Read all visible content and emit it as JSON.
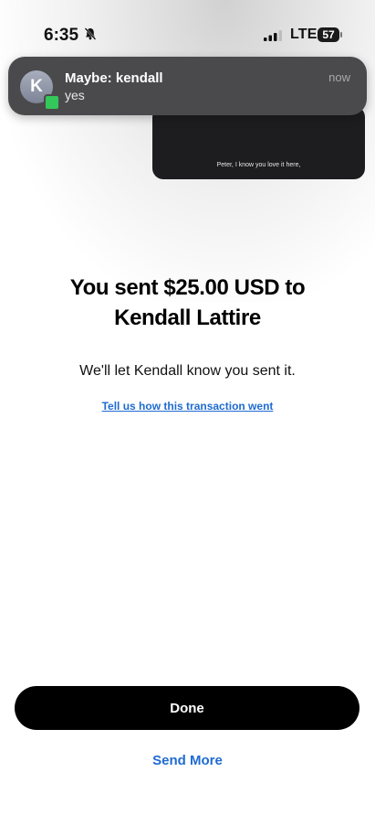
{
  "status_bar": {
    "time": "6:35",
    "network": "LTE",
    "battery_level": "57"
  },
  "notification": {
    "avatar_initial": "K",
    "title": "Maybe: kendall",
    "body": "yes",
    "time": "now"
  },
  "video_preview": {
    "caption": "Peter, I know you love it here,"
  },
  "main": {
    "headline_line1": "You sent $25.00 USD to",
    "headline_line2": "Kendall Lattire",
    "subtext": "We'll let Kendall know you sent it.",
    "feedback_link": "Tell us how this transaction went"
  },
  "actions": {
    "done_label": "Done",
    "send_more_label": "Send More"
  },
  "colors": {
    "accent": "#1f6bd1",
    "primary_button": "#000000",
    "notification_bg": "#4a4a4c"
  }
}
